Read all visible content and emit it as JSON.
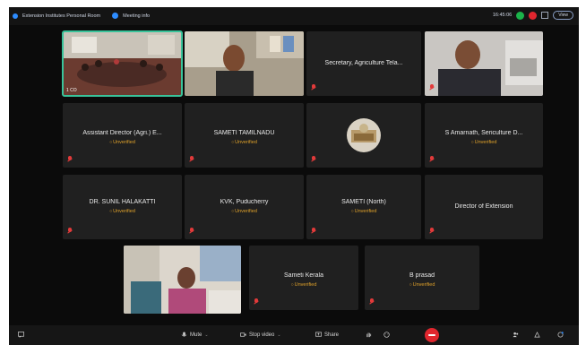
{
  "topbar": {
    "meeting_title": "Extension Institutes Personal Room",
    "meeting_info": "Meeting info",
    "time": "16:45:06",
    "view_button": "View",
    "status_colors": [
      "#1bb34a",
      "#e0262e"
    ]
  },
  "tiles": [
    {
      "name": "",
      "status": "",
      "video": true,
      "active": true,
      "caption": "1 CO"
    },
    {
      "name": "",
      "status": "",
      "video": true
    },
    {
      "name": "Secretary, Agriculture Tela...",
      "status": "",
      "video": false
    },
    {
      "name": "",
      "status": "",
      "video": true
    },
    {
      "name": "Assistant Director (Agri.) E...",
      "status": "Unverified",
      "video": false
    },
    {
      "name": "SAMETI TAMILNADU",
      "status": "Unverified",
      "video": false
    },
    {
      "name": "",
      "status": "",
      "video": false,
      "avatar": true
    },
    {
      "name": "S Amarnath, Sericulture D...",
      "status": "Unverified",
      "video": false
    },
    {
      "name": "DR. SUNIL HALAKATTI",
      "status": "Unverified",
      "video": false
    },
    {
      "name": "KVK, Puducherry",
      "status": "Unverified",
      "video": false
    },
    {
      "name": "SAMETI (North)",
      "status": "Unverified",
      "video": false
    },
    {
      "name": "Director of Extension",
      "status": "",
      "video": false
    },
    {
      "name": "",
      "status": "",
      "video": true
    },
    {
      "name": "Sameti Kerala",
      "status": "Unverified",
      "video": false
    },
    {
      "name": "B prasad",
      "status": "Unverified",
      "video": false
    }
  ],
  "toolbar": {
    "mute": "Mute",
    "stop_video": "Stop video",
    "share": "Share",
    "end_color": "#e0262e"
  },
  "icons": [
    "chat-icon",
    "mic-icon",
    "camera-icon",
    "share-icon",
    "hand-icon",
    "reaction-icon",
    "end-call-icon",
    "participants-icon",
    "apps-icon",
    "more-icon"
  ]
}
